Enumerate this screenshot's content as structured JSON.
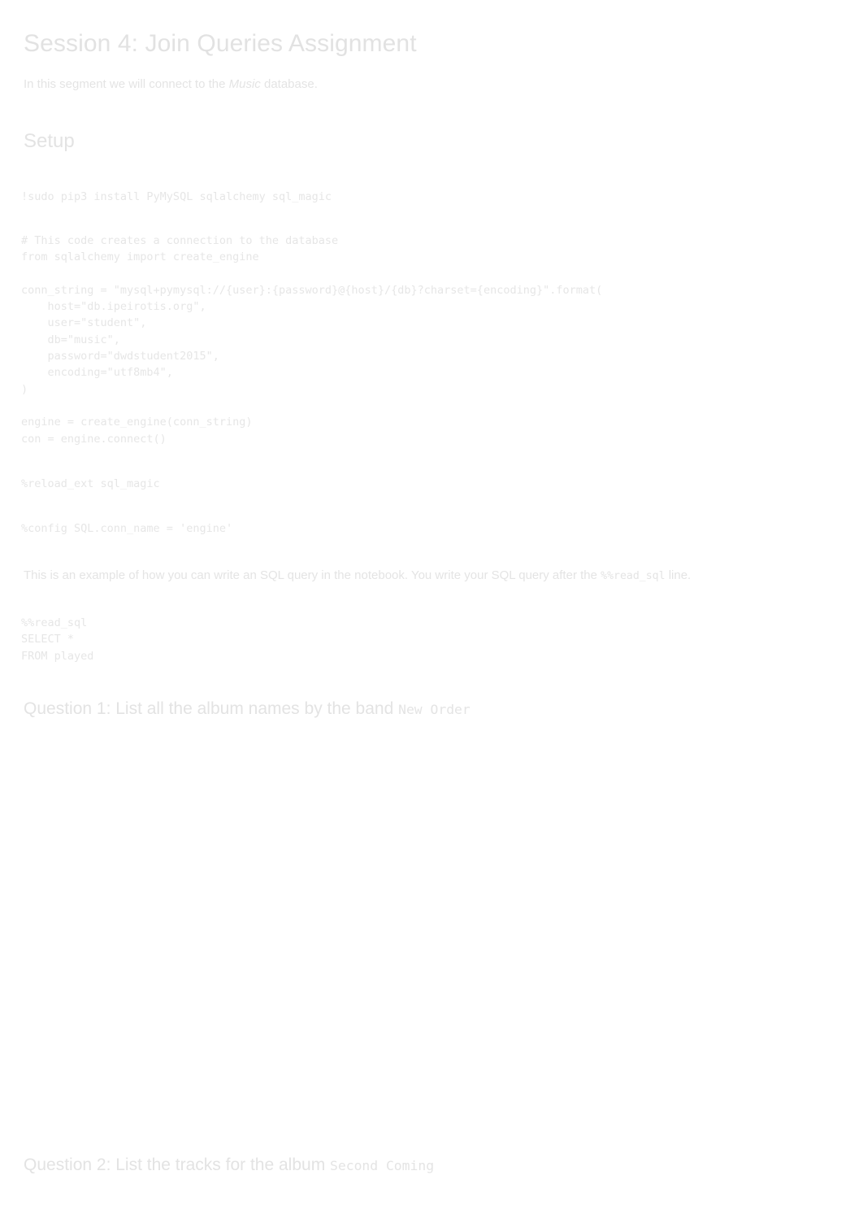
{
  "document": {
    "title": "Session 4: Join Queries Assignment",
    "intro": {
      "before": "In this segment we will connect to the ",
      "emphasis": "Music",
      "after": " database."
    },
    "setup_heading": "Setup",
    "cells": {
      "install": "!sudo pip3 install PyMySQL sqlalchemy sql_magic",
      "connection": "# This code creates a connection to the database\nfrom sqlalchemy import create_engine\n\nconn_string = \"mysql+pymysql://{user}:{password}@{host}/{db}?charset={encoding}\".format(\n    host=\"db.ipeirotis.org\",\n    user=\"student\",\n    db=\"music\",\n    password=\"dwdstudent2015\",\n    encoding=\"utf8mb4\",\n)\n\nengine = create_engine(conn_string)\ncon = engine.connect()",
      "reload_ext": "%reload_ext sql_magic",
      "config": "%config SQL.conn_name = 'engine'",
      "example_query": "%%read_sql\nSELECT *\nFROM played"
    },
    "example_note": {
      "before": "This is an example of how you can write an SQL query in the notebook. You write your SQL query after the ",
      "code": "%%read_sql",
      "after": " line."
    },
    "question1": {
      "text": "Question 1: List all the album names by the band ",
      "code": "New Order"
    },
    "question2": {
      "text": "Question 2: List the tracks for the album ",
      "code": "Second Coming"
    }
  },
  "colors": {
    "background": "#ffffff",
    "heading_text": "#e2e2e2",
    "body_text": "#e4e4e4",
    "code_text": "#e6e6e6"
  }
}
